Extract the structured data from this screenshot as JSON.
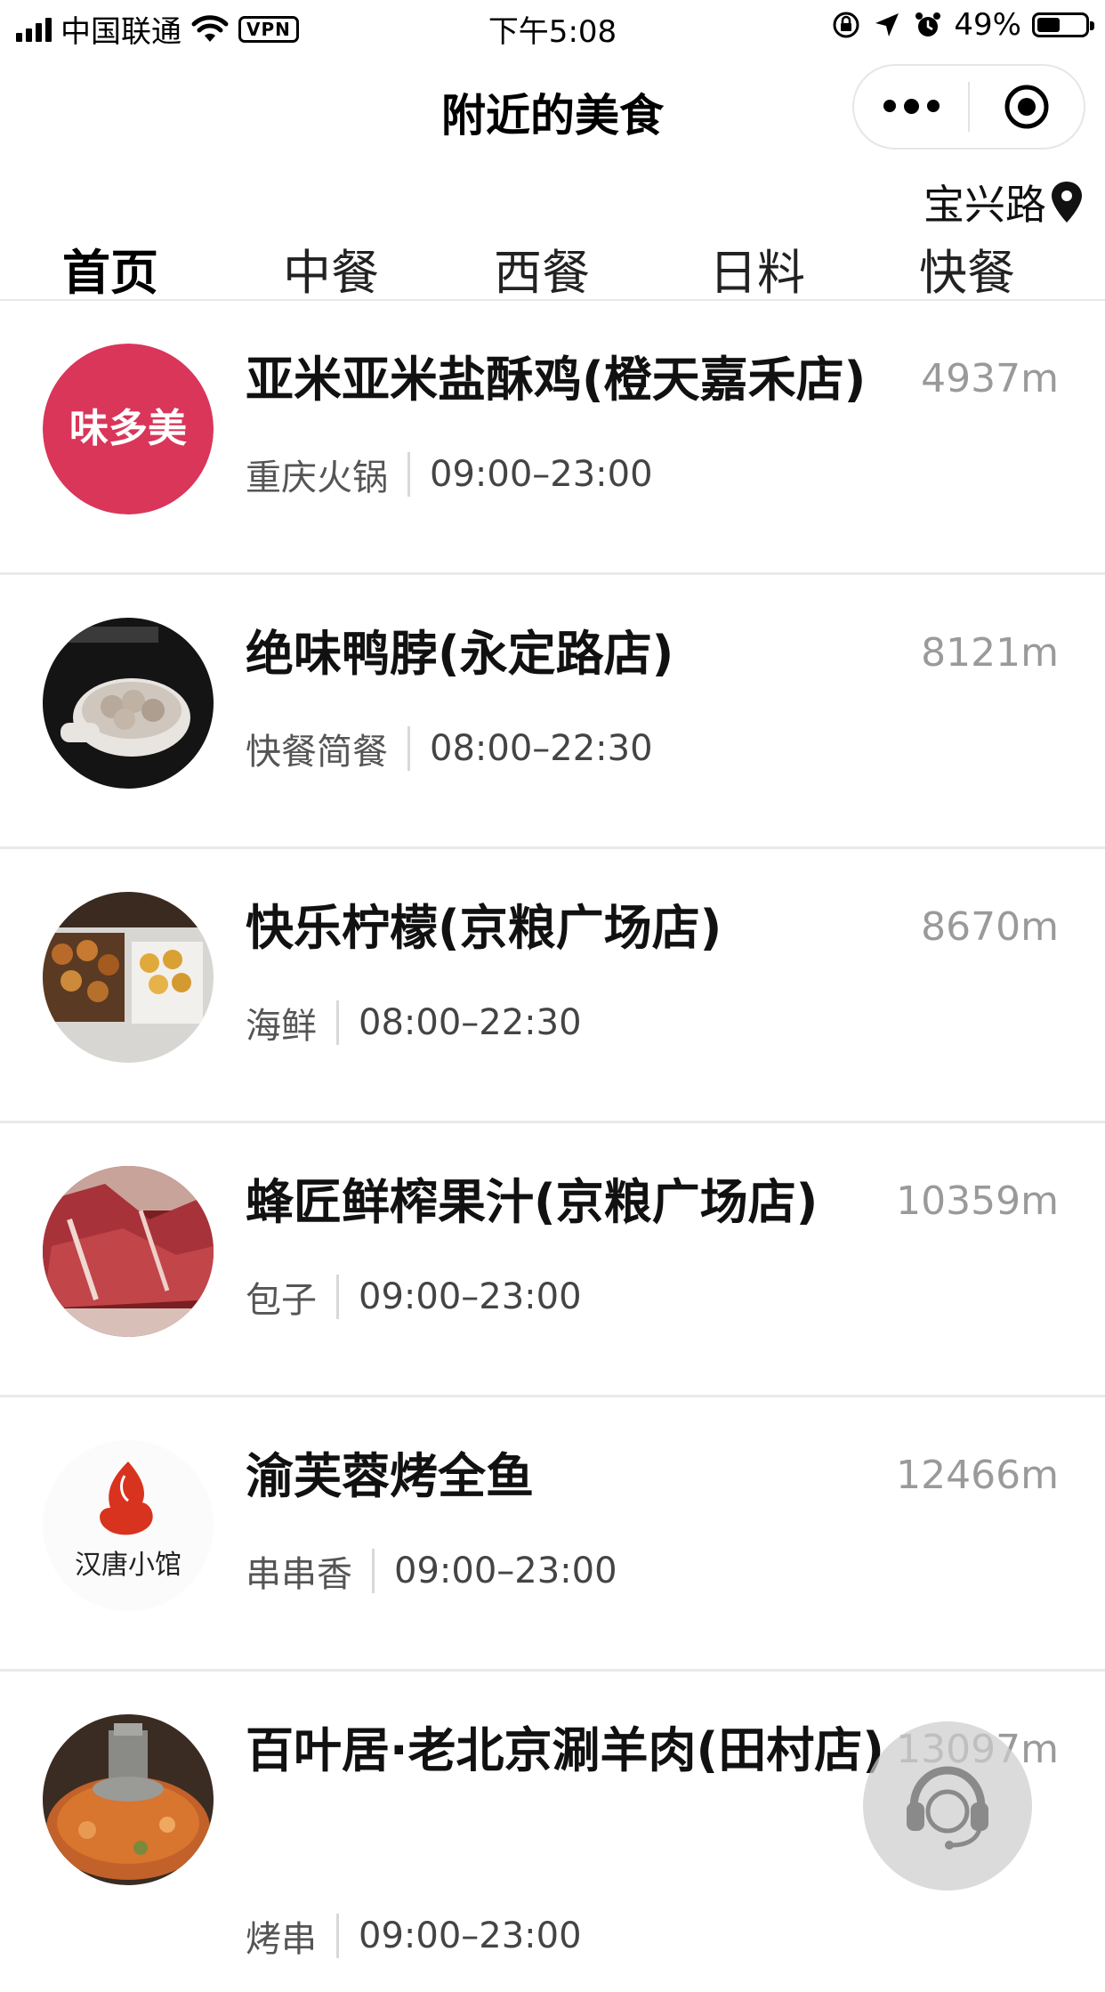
{
  "status_bar": {
    "carrier": "中国联通",
    "vpn": "VPN",
    "time": "下午5:08",
    "battery_text": "49%",
    "battery_level": 0.49
  },
  "nav": {
    "title": "附近的美食",
    "more_icon": "more-dots-icon",
    "close_icon": "target-icon"
  },
  "location": {
    "text": "宝兴路",
    "icon": "location-pin-icon"
  },
  "tabs": [
    {
      "label": "首页",
      "active": true
    },
    {
      "label": "中餐",
      "active": false
    },
    {
      "label": "西餐",
      "active": false
    },
    {
      "label": "日料",
      "active": false
    },
    {
      "label": "快餐",
      "active": false
    }
  ],
  "restaurants": [
    {
      "name": "亚米亚米盐酥鸡(橙天嘉禾店)",
      "distance": "4937m",
      "category": "重庆火锅",
      "hours": "09:00–23:00",
      "logo_text": "味多美"
    },
    {
      "name": "绝味鸭脖(永定路店)",
      "distance": "8121m",
      "category": "快餐简餐",
      "hours": "08:00–22:30"
    },
    {
      "name": "快乐柠檬(京粮广场店)",
      "distance": "8670m",
      "category": "海鲜",
      "hours": "08:00–22:30"
    },
    {
      "name": "蜂匠鲜榨果汁(京粮广场店)",
      "distance": "10359m",
      "category": "包子",
      "hours": "09:00–23:00"
    },
    {
      "name": "渝芙蓉烤全鱼",
      "distance": "12466m",
      "category": "串串香",
      "hours": "09:00–23:00",
      "logo_text": "汉唐小馆"
    },
    {
      "name": "百叶居·老北京涮羊肉(田村店)",
      "distance": "13097m",
      "category": "烤串",
      "hours": "09:00–23:00"
    }
  ],
  "service_button": {
    "icon": "headset-icon"
  },
  "colors": {
    "logo_red": "#d9365a",
    "distance_gray": "#9a9a9a",
    "divider": "#e9e9e9"
  }
}
